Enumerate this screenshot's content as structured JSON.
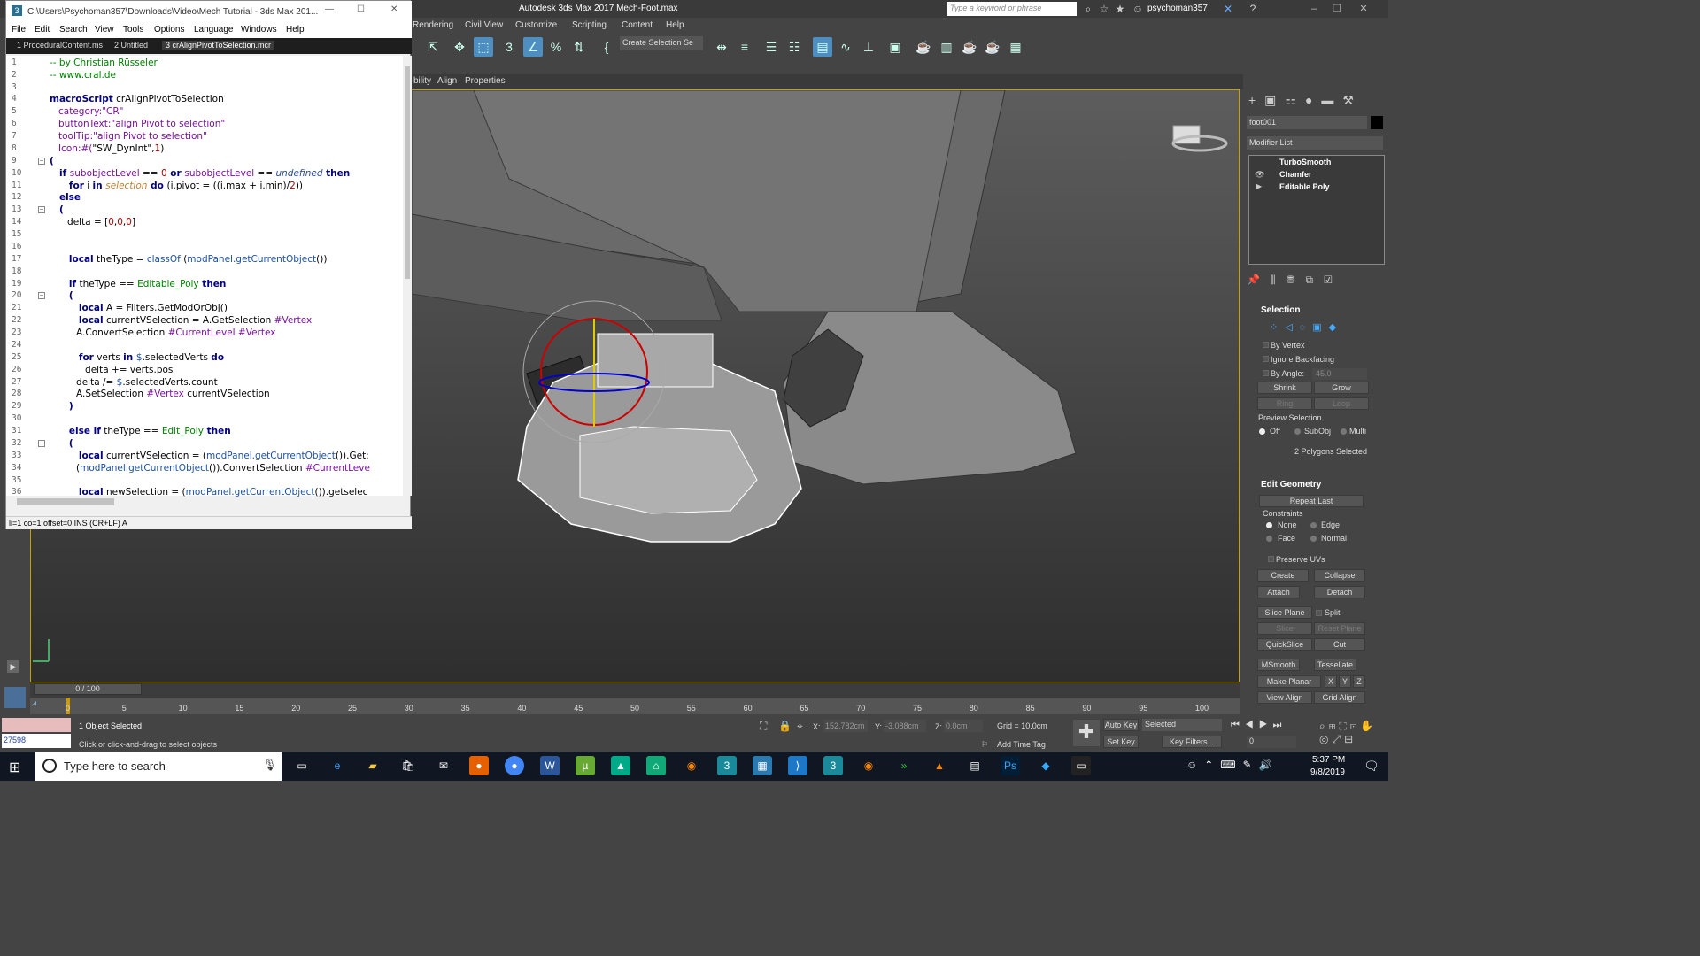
{
  "max_window": {
    "title": "Autodesk 3ds Max 2017     Mech-Foot.max",
    "search_placeholder": "Type a keyword or phrase",
    "user": "psychoman357",
    "menu": [
      "Rendering",
      "Civil View",
      "Customize",
      "Scripting",
      "Content",
      "Help"
    ],
    "selection_set": "Create Selection Se",
    "ribbon_tabs": [
      "bility",
      "Align",
      "Properties"
    ]
  },
  "editor": {
    "title": "C:\\Users\\Psychoman357\\Downloads\\Video\\Mech Tutorial - 3ds Max 201...",
    "menu": [
      "File",
      "Edit",
      "Search",
      "View",
      "Tools",
      "Options",
      "Language",
      "Windows",
      "Help"
    ],
    "tabs": [
      "1 ProceduralContent.ms",
      "2 Untitled",
      "3 crAlignPivotToSelection.mcr"
    ],
    "status": "li=1 co=1 offset=0 INS (CR+LF) A",
    "line_numbers": [
      "1",
      "2",
      "3",
      "4",
      "5",
      "6",
      "7",
      "8",
      "9",
      "10",
      "11",
      "12",
      "13",
      "14",
      "15",
      "16",
      "17",
      "18",
      "19",
      "20",
      "21",
      "22",
      "23",
      "24",
      "25",
      "26",
      "27",
      "28",
      "29",
      "30",
      "31",
      "32",
      "33",
      "34",
      "35",
      "36"
    ],
    "lines": {
      "l1": "-- by Christian Rüsseler",
      "l2": "-- www.cral.de",
      "l4a": "macroScript",
      "l4b": " crAlignPivotToSelection",
      "l5a": "   category:",
      "l5b": "\"CR\"",
      "l6a": "   buttonText:",
      "l6b": "\"align Pivot to selection\"",
      "l7a": "   toolTip:",
      "l7b": "\"align Pivot to selection\"",
      "l8a": "   Icon:#(",
      "l8b": "\"SW_DynInt\"",
      "l8c": ",",
      "l8d": "1",
      "l8e": ")",
      "l9": "(",
      "l10a": "   if ",
      "l10b": "subobjectLevel",
      "l10c": " == ",
      "l10d": "0",
      "l10e": " or ",
      "l10f": "subobjectLevel",
      "l10g": " == ",
      "l10h": "undefined",
      "l10i": " then",
      "l11a": "      for",
      "l11b": " i ",
      "l11c": "in ",
      "l11d": "selection",
      "l11e": " do ",
      "l11f": "(i.pivot = ((i.max + i.min)/",
      "l11g": "2",
      "l11h": "))",
      "l12": "   else",
      "l13": "   (",
      "l14a": "      delta = [",
      "l14b": "0",
      "l14c": ",",
      "l14d": "0",
      "l14e": ",",
      "l14f": "0",
      "l14g": "]",
      "l17a": "      local",
      "l17b": " theType = ",
      "l17c": "classOf",
      "l17d": " (",
      "l17e": "modPanel.getCurrentObject",
      "l17f": "())",
      "l19a": "      if",
      "l19b": " theType == ",
      "l19c": "Editable_Poly",
      "l19d": " then",
      "l20": "      (",
      "l21a": "         local",
      "l21b": " A = Filters.GetModOrObj()",
      "l22a": "         local",
      "l22b": " currentVSelection = A.GetSelection ",
      "l22c": "#Vertex",
      "l23a": "         A.ConvertSelection ",
      "l23b": "#CurrentLevel #Vertex",
      "l25a": "         for",
      "l25b": " verts ",
      "l25c": "in ",
      "l25d": "$",
      "l25e": ".selectedVerts ",
      "l25f": "do",
      "l26": "            delta += verts.pos",
      "l27a": "         delta /= ",
      "l27b": "$",
      "l27c": ".selectedVerts.count",
      "l28a": "         A.SetSelection ",
      "l28b": "#Vertex",
      "l28c": " currentVSelection",
      "l29": "      )",
      "l31a": "      else if",
      "l31b": " theType == ",
      "l31c": "Edit_Poly",
      "l31d": " then",
      "l32": "      (",
      "l33a": "         local",
      "l33b": " currentVSelection = (",
      "l33c": "modPanel.getCurrentObject",
      "l33d": "()).Get:",
      "l34a": "         (",
      "l34b": "modPanel.getCurrentObject",
      "l34c": "()).ConvertSelection ",
      "l34d": "#CurrentLeve",
      "l36a": "         local",
      "l36b": " newSelection = (",
      "l36c": "modPanel.getCurrentObject",
      "l36d": "()).getselec"
    }
  },
  "command_panel": {
    "object_name": "foot001",
    "modifier_list": "Modifier List",
    "stack": [
      "TurboSmooth",
      "Chamfer",
      "Editable Poly"
    ],
    "selection": {
      "header": "Selection",
      "by_vertex": "By Vertex",
      "ignore_backfacing": "Ignore Backfacing",
      "by_angle": "By Angle:",
      "angle": "45.0",
      "shrink": "Shrink",
      "grow": "Grow",
      "ring": "Ring",
      "loop": "Loop",
      "preview": "Preview Selection",
      "off": "Off",
      "subobj": "SubObj",
      "multi": "Multi",
      "status": "2 Polygons Selected"
    },
    "edit_geometry": {
      "header": "Edit Geometry",
      "repeat_last": "Repeat Last",
      "constraints": "Constraints",
      "none": "None",
      "edge": "Edge",
      "face": "Face",
      "normal": "Normal",
      "preserve_uvs": "Preserve UVs",
      "create": "Create",
      "collapse": "Collapse",
      "attach": "Attach",
      "detach": "Detach",
      "slice_plane": "Slice Plane",
      "split": "Split",
      "slice": "Slice",
      "reset_plane": "Reset Plane",
      "quickslice": "QuickSlice",
      "cut": "Cut",
      "msmooth": "MSmooth",
      "tessellate": "Tessellate",
      "make_planar": "Make Planar",
      "x": "X",
      "y": "Y",
      "z": "Z",
      "view_align": "View Align",
      "grid_align": "Grid Align"
    }
  },
  "timeline": {
    "frame": "0 / 100",
    "ticks": [
      "0",
      "5",
      "10",
      "15",
      "20",
      "25",
      "30",
      "35",
      "40",
      "45",
      "50",
      "55",
      "60",
      "65",
      "70",
      "75",
      "80",
      "85",
      "90",
      "95",
      "100"
    ]
  },
  "status": {
    "selected": "1 Object Selected",
    "prompt": "Click or click-and-drag to select objects",
    "listener": "27598",
    "x_label": "X:",
    "x": "152.782cm",
    "y_label": "Y:",
    "y": "-3.088cm",
    "z_label": "Z:",
    "z": "0.0cm",
    "grid": "Grid = 10.0cm",
    "add_time_tag": "Add Time Tag",
    "auto_key": "Auto Key",
    "set_key": "Set Key",
    "selected_dd": "Selected",
    "key_filters": "Key Filters...",
    "frame_field": "0"
  },
  "taskbar": {
    "search": "Type here to search",
    "time": "5:37 PM",
    "date": "9/8/2019"
  }
}
